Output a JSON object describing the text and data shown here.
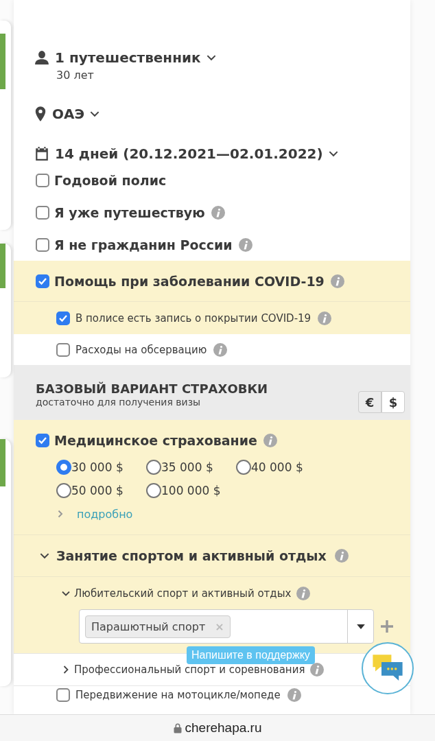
{
  "trip": {
    "travelers": "1 путешественник",
    "age": "30 лет",
    "country": "ОАЭ",
    "dates": "14 дней (20.12.2021—02.01.2022)"
  },
  "options": [
    {
      "label": "Годовой полис",
      "checked": false,
      "info": false
    },
    {
      "label": "Я уже путешествую",
      "checked": false,
      "info": true
    },
    {
      "label": "Я не гражданин России",
      "checked": false,
      "info": true
    }
  ],
  "covid": {
    "label": "Помощь при заболевании COVID-19",
    "checked": true,
    "suboptions": [
      {
        "label": "В полисе есть запись о покрытии COVID-19",
        "checked": true
      },
      {
        "label": "Расходы на обсервацию",
        "checked": false
      }
    ]
  },
  "base": {
    "title": "БАЗОВЫЙ ВАРИАНТ СТРАХОВКИ",
    "subtitle": "достаточно для получения визы",
    "currencies": [
      {
        "label": "€",
        "selected": false
      },
      {
        "label": "$",
        "selected": true
      }
    ]
  },
  "medical": {
    "label": "Медицинское страхование",
    "checked": true,
    "amounts": [
      {
        "label": "30 000 $",
        "selected": true
      },
      {
        "label": "35 000 $",
        "selected": false
      },
      {
        "label": "40 000 $",
        "selected": false
      },
      {
        "label": "50 000 $",
        "selected": false
      },
      {
        "label": "100 000 $",
        "selected": false
      }
    ],
    "more": "подробно"
  },
  "sport": {
    "label": "Занятие спортом и активный отдых",
    "expanded": true,
    "children": [
      {
        "label": "Любительский спорт и активный отдых",
        "expanded": true,
        "tags": [
          {
            "label": "Парашютный спорт",
            "remove": "×"
          }
        ]
      },
      {
        "label": "Профессиональный спорт и соревнования",
        "expanded": false
      }
    ]
  },
  "moto": {
    "label": "Передвижение на мотоцикле/мопеде",
    "checked": false
  },
  "support": "Напишите в поддержку",
  "address_bar": {
    "url": "cherehapa.ru"
  }
}
